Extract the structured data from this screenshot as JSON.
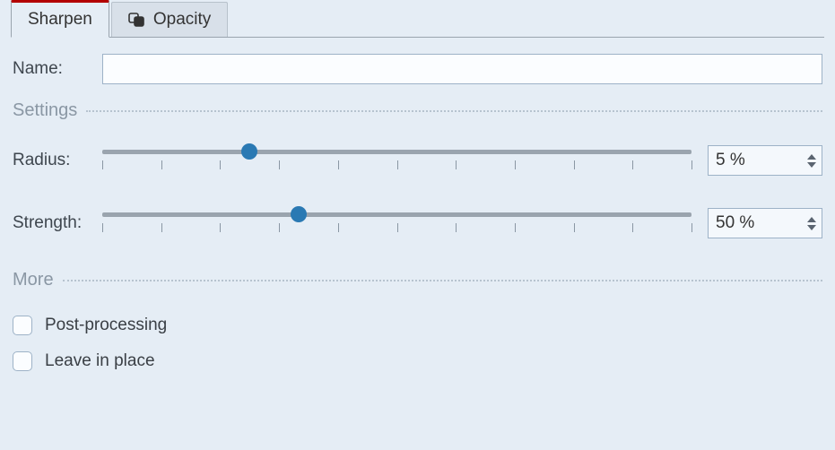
{
  "tabs": [
    {
      "label": "Sharpen",
      "active": true
    },
    {
      "label": "Opacity",
      "active": false
    }
  ],
  "name": {
    "label": "Name:",
    "value": ""
  },
  "sections": {
    "settings": {
      "title": "Settings"
    },
    "more": {
      "title": "More"
    }
  },
  "sliders": {
    "radius": {
      "label": "Radius:",
      "min": 0,
      "max": 20,
      "value": 5,
      "display": "5 %",
      "ticks": 11
    },
    "strength": {
      "label": "Strength:",
      "min": 0,
      "max": 150,
      "value": 50,
      "display": "50 %",
      "ticks": 11
    }
  },
  "checks": {
    "post_processing": {
      "label": "Post-processing",
      "checked": false
    },
    "leave_in_place": {
      "label": "Leave in place",
      "checked": false
    }
  },
  "colors": {
    "accent": "#2a79b3",
    "tab_active_top": "#b30000",
    "bg": "#e5edf5"
  }
}
